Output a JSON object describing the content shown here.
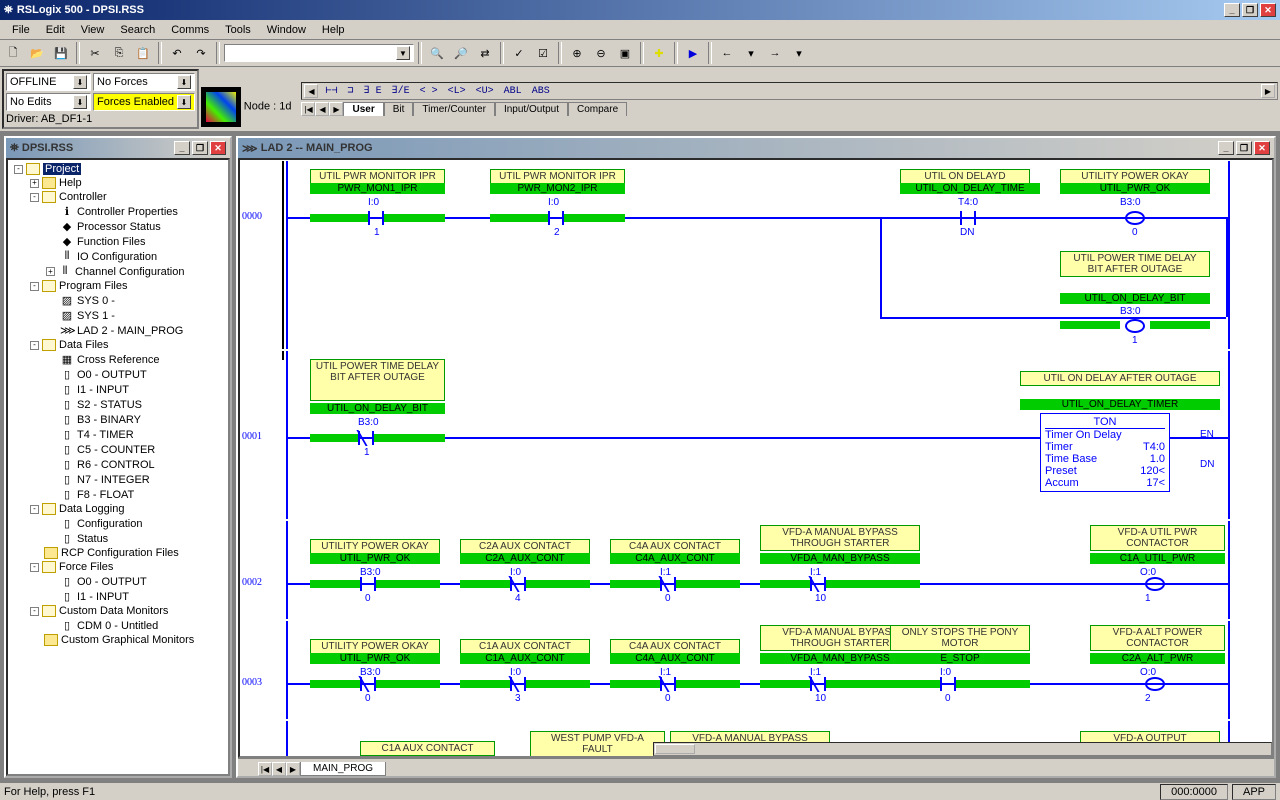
{
  "title": "RSLogix 500 - DPSI.RSS",
  "menus": [
    "File",
    "Edit",
    "View",
    "Search",
    "Comms",
    "Tools",
    "Window",
    "Help"
  ],
  "status": {
    "offline": "OFFLINE",
    "noforces": "No Forces",
    "noedits": "No Edits",
    "forcesenabled": "Forces Enabled",
    "driver": "Driver: AB_DF1-1",
    "node": "Node :  1d"
  },
  "instr_tabs": [
    "User",
    "Bit",
    "Timer/Counter",
    "Input/Output",
    "Compare"
  ],
  "tree_title": "DPSI.RSS",
  "tree": [
    {
      "l": 0,
      "exp": "-",
      "ic": "folder-open",
      "t": "Project",
      "sel": true
    },
    {
      "l": 1,
      "exp": "+",
      "ic": "folder",
      "t": "Help"
    },
    {
      "l": 1,
      "exp": "-",
      "ic": "folder-open",
      "t": "Controller"
    },
    {
      "l": 2,
      "ic": "fileicon",
      "t": "Controller Properties",
      "pre": "ℹ"
    },
    {
      "l": 2,
      "ic": "fileicon",
      "t": "Processor Status",
      "pre": "◆"
    },
    {
      "l": 2,
      "ic": "fileicon",
      "t": "Function Files",
      "pre": "◆"
    },
    {
      "l": 2,
      "ic": "fileicon",
      "t": "IO Configuration",
      "pre": "⦀"
    },
    {
      "l": 2,
      "exp": "+",
      "ic": "fileicon",
      "t": "Channel Configuration",
      "pre": "⦀"
    },
    {
      "l": 1,
      "exp": "-",
      "ic": "folder-open",
      "t": "Program Files"
    },
    {
      "l": 2,
      "ic": "fileicon",
      "t": "SYS 0 -",
      "pre": "▨"
    },
    {
      "l": 2,
      "ic": "fileicon",
      "t": "SYS 1 -",
      "pre": "▨"
    },
    {
      "l": 2,
      "ic": "fileicon",
      "t": "LAD 2 - MAIN_PROG",
      "pre": "⋙"
    },
    {
      "l": 1,
      "exp": "-",
      "ic": "folder-open",
      "t": "Data Files"
    },
    {
      "l": 2,
      "ic": "fileicon",
      "t": "Cross Reference",
      "pre": "▦"
    },
    {
      "l": 2,
      "ic": "fileicon",
      "t": "O0 - OUTPUT",
      "pre": "▯"
    },
    {
      "l": 2,
      "ic": "fileicon",
      "t": "I1 - INPUT",
      "pre": "▯"
    },
    {
      "l": 2,
      "ic": "fileicon",
      "t": "S2 - STATUS",
      "pre": "▯"
    },
    {
      "l": 2,
      "ic": "fileicon",
      "t": "B3 - BINARY",
      "pre": "▯"
    },
    {
      "l": 2,
      "ic": "fileicon",
      "t": "T4 - TIMER",
      "pre": "▯"
    },
    {
      "l": 2,
      "ic": "fileicon",
      "t": "C5 - COUNTER",
      "pre": "▯"
    },
    {
      "l": 2,
      "ic": "fileicon",
      "t": "R6 - CONTROL",
      "pre": "▯"
    },
    {
      "l": 2,
      "ic": "fileicon",
      "t": "N7 - INTEGER",
      "pre": "▯"
    },
    {
      "l": 2,
      "ic": "fileicon",
      "t": "F8 - FLOAT",
      "pre": "▯"
    },
    {
      "l": 1,
      "exp": "-",
      "ic": "folder-open",
      "t": "Data Logging"
    },
    {
      "l": 2,
      "ic": "fileicon",
      "t": "Configuration",
      "pre": "▯"
    },
    {
      "l": 2,
      "ic": "fileicon",
      "t": "Status",
      "pre": "▯"
    },
    {
      "l": 1,
      "ic": "folder",
      "t": "RCP Configuration Files"
    },
    {
      "l": 1,
      "exp": "-",
      "ic": "folder-open",
      "t": "Force Files"
    },
    {
      "l": 2,
      "ic": "fileicon",
      "t": "O0 - OUTPUT",
      "pre": "▯"
    },
    {
      "l": 2,
      "ic": "fileicon",
      "t": "I1 - INPUT",
      "pre": "▯"
    },
    {
      "l": 1,
      "exp": "-",
      "ic": "folder-open",
      "t": "Custom Data Monitors"
    },
    {
      "l": 2,
      "ic": "fileicon",
      "t": "CDM 0 - Untitled",
      "pre": "▯"
    },
    {
      "l": 1,
      "ic": "folder",
      "t": "Custom Graphical Monitors"
    }
  ],
  "ladder_title": "LAD 2 -- MAIN_PROG",
  "main_tab": "MAIN_PROG",
  "rungs": {
    "r0": {
      "num": "0000",
      "e1": {
        "d": "UTIL PWR MONITOR IPR",
        "t": "PWR_MON1_IPR",
        "a": "I:0",
        "b": "1"
      },
      "e2": {
        "d": "UTIL PWR MONITOR IPR",
        "t": "PWR_MON2_IPR",
        "a": "I:0",
        "b": "2"
      },
      "e3": {
        "d": "UTIL ON DELAYD",
        "t": "UTIL_ON_DELAY_TIME",
        "a": "T4:0",
        "b": "DN"
      },
      "e4": {
        "d": "UTILITY POWER OKAY",
        "t": "UTIL_PWR_OK",
        "a": "B3:0",
        "b": "0"
      },
      "e5": {
        "d": "UTIL POWER TIME DELAY BIT AFTER OUTAGE",
        "t": "UTIL_ON_DELAY_BIT",
        "a": "B3:0",
        "b": "1"
      }
    },
    "r1": {
      "num": "0001",
      "e1": {
        "d": "UTIL POWER TIME DELAY BIT AFTER OUTAGE",
        "t": "UTIL_ON_DELAY_BIT",
        "a": "B3:0",
        "b": "1"
      },
      "e2": {
        "d": "UTIL ON DELAY AFTER OUTAGE",
        "t": "UTIL_ON_DELAY_TIMER"
      },
      "ton": {
        "title": "TON",
        "l1": "Timer On Delay",
        "l2": "Timer",
        "v2": "T4:0",
        "l3": "Time Base",
        "v3": "1.0",
        "l4": "Preset",
        "v4": "120<",
        "l5": "Accum",
        "v5": "17<",
        "en": "EN",
        "dn": "DN"
      }
    },
    "r2": {
      "num": "0002",
      "e1": {
        "d": "UTILITY POWER OKAY",
        "t": "UTIL_PWR_OK",
        "a": "B3:0",
        "b": "0"
      },
      "e2": {
        "d": "C2A AUX CONTACT",
        "t": "C2A_AUX_CONT",
        "a": "I:0",
        "b": "4"
      },
      "e3": {
        "d": "C4A AUX CONTACT",
        "t": "C4A_AUX_CONT",
        "a": "I:1",
        "b": "0"
      },
      "e4": {
        "d": "VFD-A MANUAL BYPASS THROUGH STARTER",
        "t": "VFDA_MAN_BYPASS",
        "a": "I:1",
        "b": "10"
      },
      "e5": {
        "d": "VFD-A UTIL PWR CONTACTOR",
        "t": "C1A_UTIL_PWR",
        "a": "O:0",
        "b": "1"
      }
    },
    "r3": {
      "num": "0003",
      "e1": {
        "d": "UTILITY POWER OKAY",
        "t": "UTIL_PWR_OK",
        "a": "B3:0",
        "b": "0"
      },
      "e2": {
        "d": "C1A AUX CONTACT",
        "t": "C1A_AUX_CONT",
        "a": "I:0",
        "b": "3"
      },
      "e3": {
        "d": "C4A AUX CONTACT",
        "t": "C4A_AUX_CONT",
        "a": "I:1",
        "b": "0"
      },
      "e4": {
        "d": "VFD-A MANUAL BYPASS THROUGH STARTER",
        "t": "VFDA_MAN_BYPASS",
        "a": "I:1",
        "b": "10"
      },
      "e5": {
        "d": "ONLY STOPS THE PONY MOTOR",
        "t": "E_STOP",
        "a": "I:0",
        "b": "0"
      },
      "e6": {
        "d": "VFD-A ALT POWER CONTACTOR",
        "t": "C2A_ALT_PWR",
        "a": "O:0",
        "b": "2"
      }
    },
    "r4": {
      "e1": {
        "d": "C1A AUX CONTACT"
      },
      "e2": {
        "d": "WEST PUMP VFD-A FAULT"
      },
      "e3": {
        "d": "VFD-A MANUAL BYPASS THROUGH STARTER"
      },
      "e4": {
        "d": "VFD-A OUTPUT CONTACTOR"
      }
    }
  },
  "statusbar": {
    "help": "For Help, press F1",
    "pos": "000:0000",
    "mode": "APP"
  }
}
